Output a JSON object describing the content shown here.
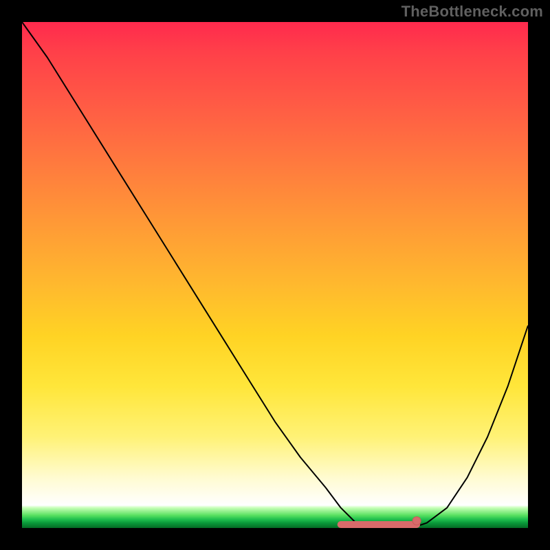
{
  "watermark": "TheBottleneck.com",
  "chart_data": {
    "type": "line",
    "title": "",
    "xlabel": "",
    "ylabel": "",
    "xlim": [
      0,
      100
    ],
    "ylim": [
      0,
      100
    ],
    "x": [
      0,
      5,
      10,
      15,
      20,
      25,
      30,
      35,
      40,
      45,
      50,
      55,
      60,
      63,
      66,
      70,
      74,
      77,
      80,
      84,
      88,
      92,
      96,
      100
    ],
    "y": [
      100,
      93,
      85,
      77,
      69,
      61,
      53,
      45,
      37,
      29,
      21,
      14,
      8,
      4,
      1,
      0,
      0,
      0,
      1,
      4,
      10,
      18,
      28,
      40
    ],
    "optimal_band_x": [
      63,
      78
    ],
    "marker_x": 78,
    "marker_y": 1,
    "colors": {
      "top": "#ff2a4d",
      "mid": "#ffe63a",
      "band": "#1fbf4e",
      "line": "#000000",
      "marker": "#d86a6a"
    },
    "legend": [],
    "grid": false
  }
}
